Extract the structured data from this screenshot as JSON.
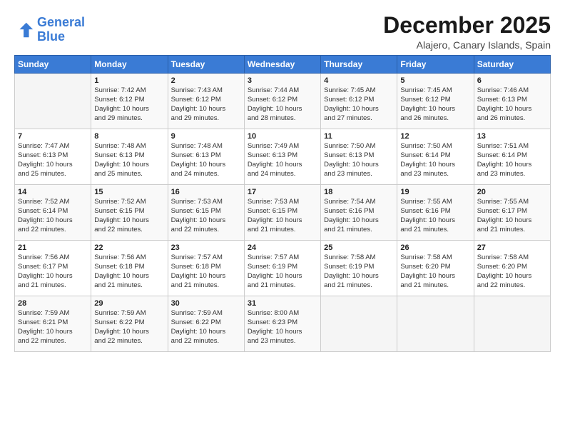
{
  "logo": {
    "line1": "General",
    "line2": "Blue"
  },
  "title": "December 2025",
  "subtitle": "Alajero, Canary Islands, Spain",
  "header": {
    "days": [
      "Sunday",
      "Monday",
      "Tuesday",
      "Wednesday",
      "Thursday",
      "Friday",
      "Saturday"
    ]
  },
  "weeks": [
    [
      {
        "day": "",
        "content": ""
      },
      {
        "day": "1",
        "content": "Sunrise: 7:42 AM\nSunset: 6:12 PM\nDaylight: 10 hours\nand 29 minutes."
      },
      {
        "day": "2",
        "content": "Sunrise: 7:43 AM\nSunset: 6:12 PM\nDaylight: 10 hours\nand 29 minutes."
      },
      {
        "day": "3",
        "content": "Sunrise: 7:44 AM\nSunset: 6:12 PM\nDaylight: 10 hours\nand 28 minutes."
      },
      {
        "day": "4",
        "content": "Sunrise: 7:45 AM\nSunset: 6:12 PM\nDaylight: 10 hours\nand 27 minutes."
      },
      {
        "day": "5",
        "content": "Sunrise: 7:45 AM\nSunset: 6:12 PM\nDaylight: 10 hours\nand 26 minutes."
      },
      {
        "day": "6",
        "content": "Sunrise: 7:46 AM\nSunset: 6:13 PM\nDaylight: 10 hours\nand 26 minutes."
      }
    ],
    [
      {
        "day": "7",
        "content": "Sunrise: 7:47 AM\nSunset: 6:13 PM\nDaylight: 10 hours\nand 25 minutes."
      },
      {
        "day": "8",
        "content": "Sunrise: 7:48 AM\nSunset: 6:13 PM\nDaylight: 10 hours\nand 25 minutes."
      },
      {
        "day": "9",
        "content": "Sunrise: 7:48 AM\nSunset: 6:13 PM\nDaylight: 10 hours\nand 24 minutes."
      },
      {
        "day": "10",
        "content": "Sunrise: 7:49 AM\nSunset: 6:13 PM\nDaylight: 10 hours\nand 24 minutes."
      },
      {
        "day": "11",
        "content": "Sunrise: 7:50 AM\nSunset: 6:13 PM\nDaylight: 10 hours\nand 23 minutes."
      },
      {
        "day": "12",
        "content": "Sunrise: 7:50 AM\nSunset: 6:14 PM\nDaylight: 10 hours\nand 23 minutes."
      },
      {
        "day": "13",
        "content": "Sunrise: 7:51 AM\nSunset: 6:14 PM\nDaylight: 10 hours\nand 23 minutes."
      }
    ],
    [
      {
        "day": "14",
        "content": "Sunrise: 7:52 AM\nSunset: 6:14 PM\nDaylight: 10 hours\nand 22 minutes."
      },
      {
        "day": "15",
        "content": "Sunrise: 7:52 AM\nSunset: 6:15 PM\nDaylight: 10 hours\nand 22 minutes."
      },
      {
        "day": "16",
        "content": "Sunrise: 7:53 AM\nSunset: 6:15 PM\nDaylight: 10 hours\nand 22 minutes."
      },
      {
        "day": "17",
        "content": "Sunrise: 7:53 AM\nSunset: 6:15 PM\nDaylight: 10 hours\nand 21 minutes."
      },
      {
        "day": "18",
        "content": "Sunrise: 7:54 AM\nSunset: 6:16 PM\nDaylight: 10 hours\nand 21 minutes."
      },
      {
        "day": "19",
        "content": "Sunrise: 7:55 AM\nSunset: 6:16 PM\nDaylight: 10 hours\nand 21 minutes."
      },
      {
        "day": "20",
        "content": "Sunrise: 7:55 AM\nSunset: 6:17 PM\nDaylight: 10 hours\nand 21 minutes."
      }
    ],
    [
      {
        "day": "21",
        "content": "Sunrise: 7:56 AM\nSunset: 6:17 PM\nDaylight: 10 hours\nand 21 minutes."
      },
      {
        "day": "22",
        "content": "Sunrise: 7:56 AM\nSunset: 6:18 PM\nDaylight: 10 hours\nand 21 minutes."
      },
      {
        "day": "23",
        "content": "Sunrise: 7:57 AM\nSunset: 6:18 PM\nDaylight: 10 hours\nand 21 minutes."
      },
      {
        "day": "24",
        "content": "Sunrise: 7:57 AM\nSunset: 6:19 PM\nDaylight: 10 hours\nand 21 minutes."
      },
      {
        "day": "25",
        "content": "Sunrise: 7:58 AM\nSunset: 6:19 PM\nDaylight: 10 hours\nand 21 minutes."
      },
      {
        "day": "26",
        "content": "Sunrise: 7:58 AM\nSunset: 6:20 PM\nDaylight: 10 hours\nand 21 minutes."
      },
      {
        "day": "27",
        "content": "Sunrise: 7:58 AM\nSunset: 6:20 PM\nDaylight: 10 hours\nand 22 minutes."
      }
    ],
    [
      {
        "day": "28",
        "content": "Sunrise: 7:59 AM\nSunset: 6:21 PM\nDaylight: 10 hours\nand 22 minutes."
      },
      {
        "day": "29",
        "content": "Sunrise: 7:59 AM\nSunset: 6:22 PM\nDaylight: 10 hours\nand 22 minutes."
      },
      {
        "day": "30",
        "content": "Sunrise: 7:59 AM\nSunset: 6:22 PM\nDaylight: 10 hours\nand 22 minutes."
      },
      {
        "day": "31",
        "content": "Sunrise: 8:00 AM\nSunset: 6:23 PM\nDaylight: 10 hours\nand 23 minutes."
      },
      {
        "day": "",
        "content": ""
      },
      {
        "day": "",
        "content": ""
      },
      {
        "day": "",
        "content": ""
      }
    ]
  ]
}
